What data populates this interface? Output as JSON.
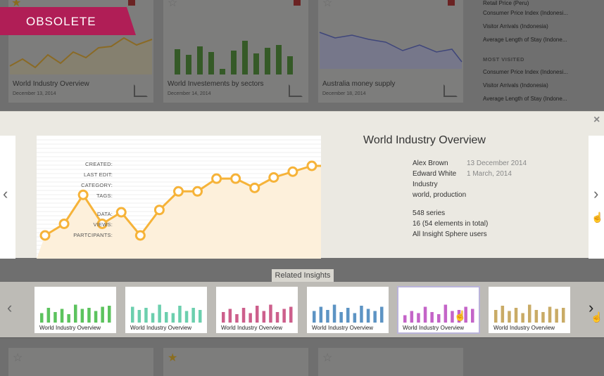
{
  "ribbon": {
    "label": "OBSOLETE"
  },
  "background": {
    "cards": [
      {
        "title": "World Industry Overview",
        "date": "December 13, 2014"
      },
      {
        "title": "World Investements by sectors",
        "date": "December 14, 2014"
      },
      {
        "title": "Australia money supply",
        "date": "December 18, 2014"
      }
    ],
    "sidebar": {
      "recent": [
        "Retail Price (Peru)",
        "Consumer Price Index (Indonesi...",
        "Visitor Arrivals (Indonesia)",
        "Average Length of Stay (Indone..."
      ],
      "most_visited_heading": "MOST VISITED",
      "most_visited": [
        "Consumer Price Index (Indonesi...",
        "Visitor Arrivals (Indonesia)",
        "Average Length of Stay (Indone..."
      ]
    }
  },
  "detail": {
    "close_glyph": "×",
    "prev_glyph": "‹",
    "next_glyph": "›",
    "title": "World Industry Overview",
    "meta": {
      "created_label": "CREATED:",
      "created_by": "Alex Brown",
      "created_date": "13 December 2014",
      "last_edit_label": "LAST EDIT:",
      "last_edit_by": "Edward White",
      "last_edit_date": "1 March, 2014",
      "category_label": "CATEGORY:",
      "category": "Industry",
      "tags_label": "TAGS:",
      "tags": "world, production",
      "data_label": "DATA:",
      "data": "548 series",
      "views_label": "VIEWS:",
      "views": "16 (54 elements in total)",
      "participants_label": "PARTCIPANTS:",
      "participants": "All Insight Sphere users"
    }
  },
  "related": {
    "label": "Related Insights",
    "prev_glyph": "‹",
    "next_glyph": "›",
    "items": [
      {
        "title": "World Industry Overview",
        "color": "#5cc35e",
        "values": [
          0.45,
          0.7,
          0.5,
          0.65,
          0.4,
          0.85,
          0.65,
          0.7,
          0.55,
          0.75,
          0.8
        ]
      },
      {
        "title": "World Industry Overview",
        "color": "#6ccfae",
        "values": [
          0.75,
          0.6,
          0.7,
          0.45,
          0.85,
          0.5,
          0.45,
          0.8,
          0.55,
          0.7,
          0.6
        ]
      },
      {
        "title": "World Industry Overview",
        "color": "#cd5f8c",
        "values": [
          0.5,
          0.65,
          0.4,
          0.7,
          0.45,
          0.8,
          0.55,
          0.85,
          0.5,
          0.65,
          0.75
        ]
      },
      {
        "title": "World Industry Overview",
        "color": "#5d94c4",
        "values": [
          0.55,
          0.75,
          0.6,
          0.85,
          0.5,
          0.7,
          0.45,
          0.8,
          0.65,
          0.55,
          0.75
        ]
      },
      {
        "title": "World Industry Overview",
        "color": "#c464c8",
        "values": [
          0.35,
          0.55,
          0.45,
          0.75,
          0.5,
          0.4,
          0.85,
          0.55,
          0.6,
          0.75,
          0.65
        ]
      },
      {
        "title": "World Industry Overview",
        "color": "#c9ab66",
        "values": [
          0.6,
          0.8,
          0.55,
          0.7,
          0.45,
          0.85,
          0.6,
          0.5,
          0.75,
          0.65,
          0.7
        ]
      }
    ]
  },
  "chart_data": {
    "type": "line",
    "x": [
      1,
      2,
      3,
      4,
      5,
      6,
      7,
      8,
      9,
      10,
      11,
      12,
      13,
      14,
      15,
      16
    ],
    "values": [
      2,
      3,
      5.5,
      3,
      4,
      2,
      4.2,
      5.8,
      5.8,
      6.9,
      6.9,
      6.1,
      7,
      7.5,
      8,
      8
    ],
    "ylim": [
      0,
      10
    ],
    "line_color": "#f6b339",
    "fill_color": "#fdf0db",
    "grid": true
  }
}
